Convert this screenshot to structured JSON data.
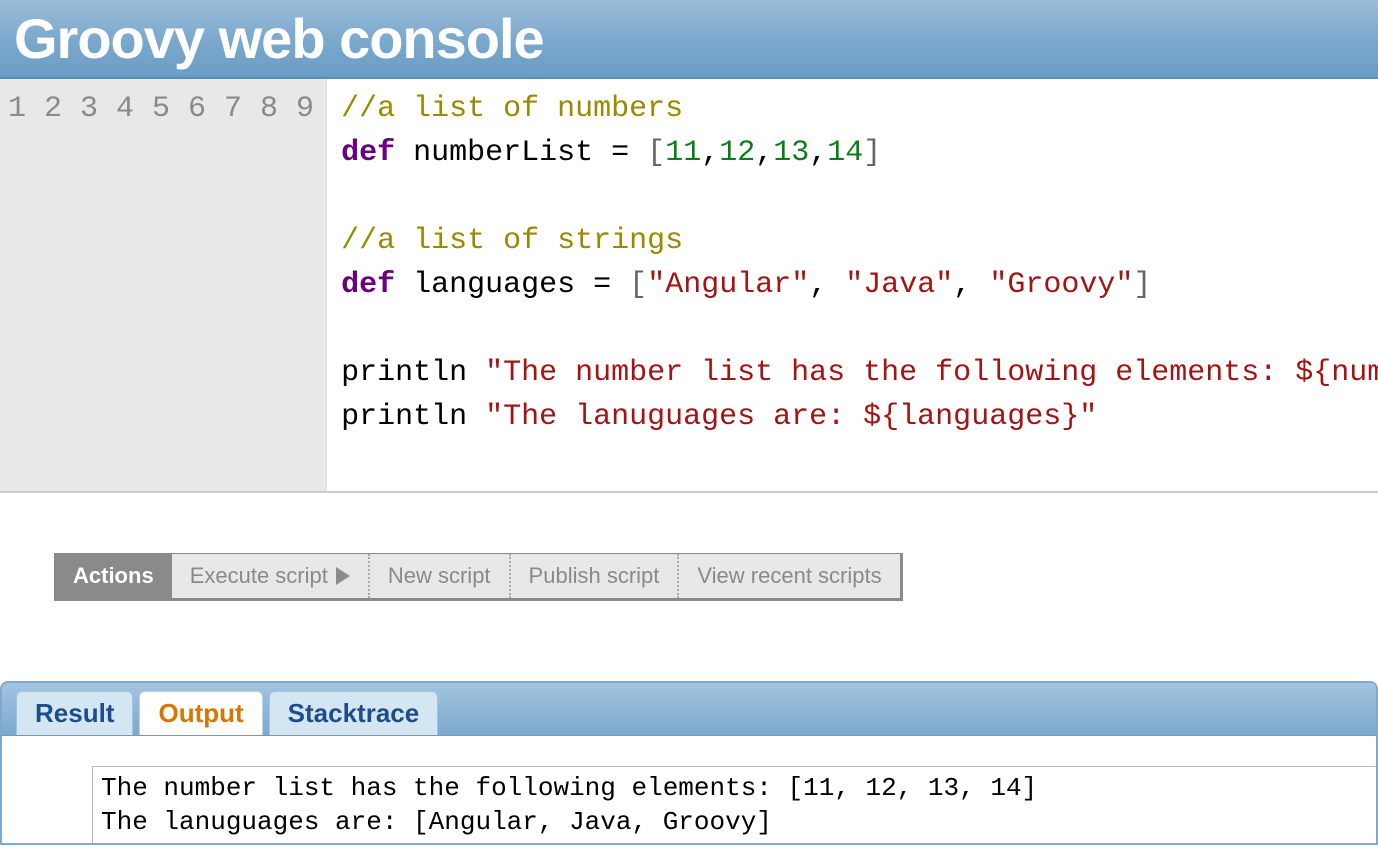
{
  "header": {
    "title": "Groovy web console"
  },
  "editor": {
    "lineNumbers": [
      "1",
      "2",
      "3",
      "4",
      "5",
      "6",
      "7",
      "8",
      "9"
    ],
    "lines": [
      {
        "tokens": [
          {
            "cls": "tok-comment",
            "t": "//a list of numbers"
          }
        ]
      },
      {
        "tokens": [
          {
            "cls": "tok-keyword",
            "t": "def"
          },
          {
            "cls": "",
            "t": " "
          },
          {
            "cls": "tok-ident",
            "t": "numberList"
          },
          {
            "cls": "",
            "t": " "
          },
          {
            "cls": "tok-op",
            "t": "="
          },
          {
            "cls": "",
            "t": " "
          },
          {
            "cls": "tok-bracket",
            "t": "["
          },
          {
            "cls": "tok-number",
            "t": "11"
          },
          {
            "cls": "tok-op",
            "t": ","
          },
          {
            "cls": "tok-number",
            "t": "12"
          },
          {
            "cls": "tok-op",
            "t": ","
          },
          {
            "cls": "tok-number",
            "t": "13"
          },
          {
            "cls": "tok-op",
            "t": ","
          },
          {
            "cls": "tok-number",
            "t": "14"
          },
          {
            "cls": "tok-bracket",
            "t": "]"
          }
        ]
      },
      {
        "tokens": [
          {
            "cls": "",
            "t": ""
          }
        ]
      },
      {
        "tokens": [
          {
            "cls": "tok-comment",
            "t": "//a list of strings"
          }
        ]
      },
      {
        "tokens": [
          {
            "cls": "tok-keyword",
            "t": "def"
          },
          {
            "cls": "",
            "t": " "
          },
          {
            "cls": "tok-ident",
            "t": "languages"
          },
          {
            "cls": "",
            "t": " "
          },
          {
            "cls": "tok-op",
            "t": "="
          },
          {
            "cls": "",
            "t": " "
          },
          {
            "cls": "tok-bracket",
            "t": "["
          },
          {
            "cls": "tok-string",
            "t": "\"Angular\""
          },
          {
            "cls": "tok-op",
            "t": ","
          },
          {
            "cls": "",
            "t": " "
          },
          {
            "cls": "tok-string",
            "t": "\"Java\""
          },
          {
            "cls": "tok-op",
            "t": ","
          },
          {
            "cls": "",
            "t": " "
          },
          {
            "cls": "tok-string",
            "t": "\"Groovy\""
          },
          {
            "cls": "tok-bracket",
            "t": "]"
          }
        ]
      },
      {
        "tokens": [
          {
            "cls": "",
            "t": ""
          }
        ]
      },
      {
        "tokens": [
          {
            "cls": "tok-ident",
            "t": "println"
          },
          {
            "cls": "",
            "t": " "
          },
          {
            "cls": "tok-string",
            "t": "\"The number list has the following elements: ${numberList}\""
          }
        ]
      },
      {
        "tokens": [
          {
            "cls": "tok-ident",
            "t": "println"
          },
          {
            "cls": "",
            "t": " "
          },
          {
            "cls": "tok-string",
            "t": "\"The lanuguages are: ${languages}\""
          }
        ]
      },
      {
        "tokens": [
          {
            "cls": "",
            "t": ""
          }
        ]
      }
    ]
  },
  "actions": {
    "label": "Actions",
    "items": [
      {
        "label": "Execute script",
        "icon": "play"
      },
      {
        "label": "New script",
        "icon": null
      },
      {
        "label": "Publish script",
        "icon": null
      },
      {
        "label": "View recent scripts",
        "icon": null
      }
    ]
  },
  "tabs": {
    "items": [
      {
        "label": "Result",
        "active": false
      },
      {
        "label": "Output",
        "active": true
      },
      {
        "label": "Stacktrace",
        "active": false
      }
    ]
  },
  "output": {
    "text": "The number list has the following elements: [11, 12, 13, 14]\nThe lanuguages are: [Angular, Java, Groovy]"
  }
}
